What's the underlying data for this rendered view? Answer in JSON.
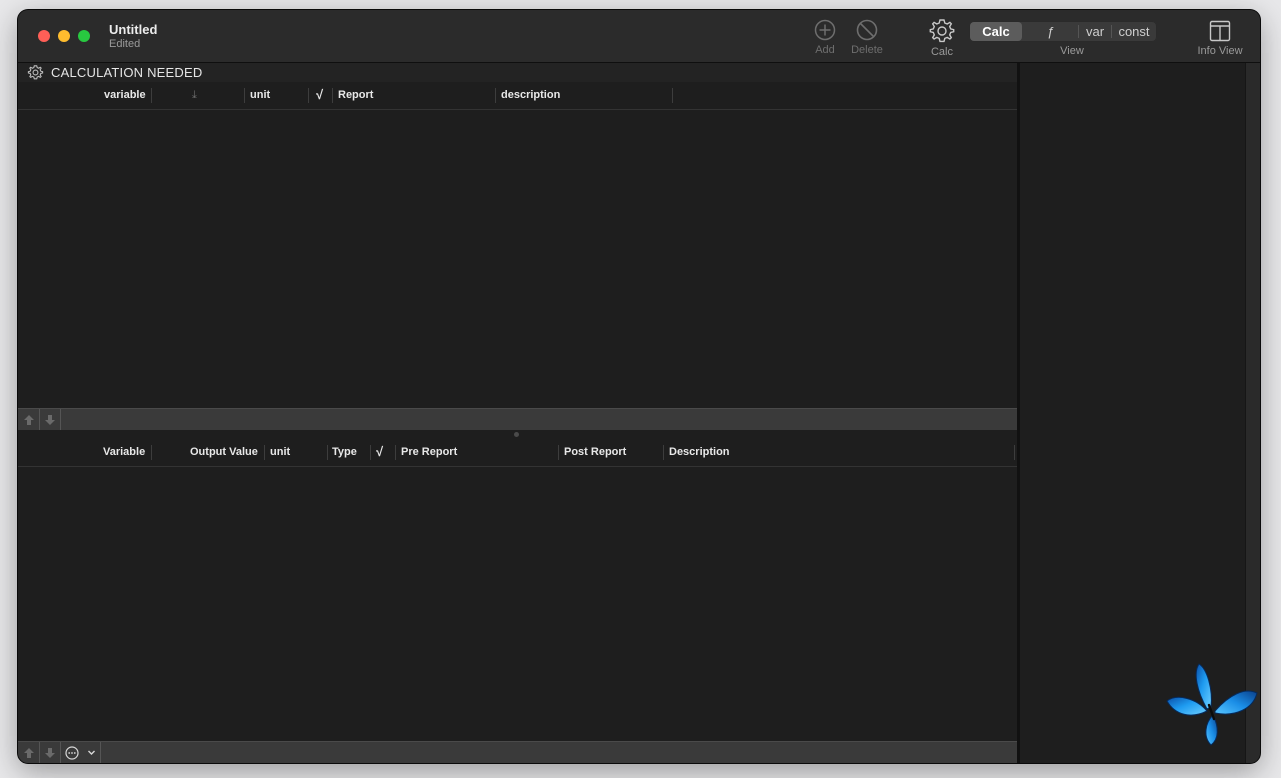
{
  "window": {
    "title": "Untitled",
    "subtitle": "Edited"
  },
  "toolbar": {
    "add_label": "Add",
    "delete_label": "Delete",
    "calc_label": "Calc",
    "view_label": "View",
    "info_view_label": "Info View",
    "view_segments": [
      {
        "label": "Calc",
        "selected": true
      },
      {
        "label": "ƒ",
        "selected": false
      },
      {
        "label": "var",
        "selected": false
      },
      {
        "label": "const",
        "selected": false
      }
    ]
  },
  "status": {
    "text": "CALCULATION NEEDED"
  },
  "input_table": {
    "columns": [
      "variable",
      "⤓",
      "unit",
      "√",
      "Report",
      "description"
    ],
    "rows": []
  },
  "output_table": {
    "columns": [
      "Variable",
      "Output Value",
      "unit",
      "Type",
      "√",
      "Pre Report",
      "Post Report",
      "Description"
    ],
    "rows": []
  },
  "colors": {
    "window_bg": "#1e1e1e",
    "toolbar_bg": "#2b2b2b",
    "accent_butterfly": "#1e9bf0"
  }
}
